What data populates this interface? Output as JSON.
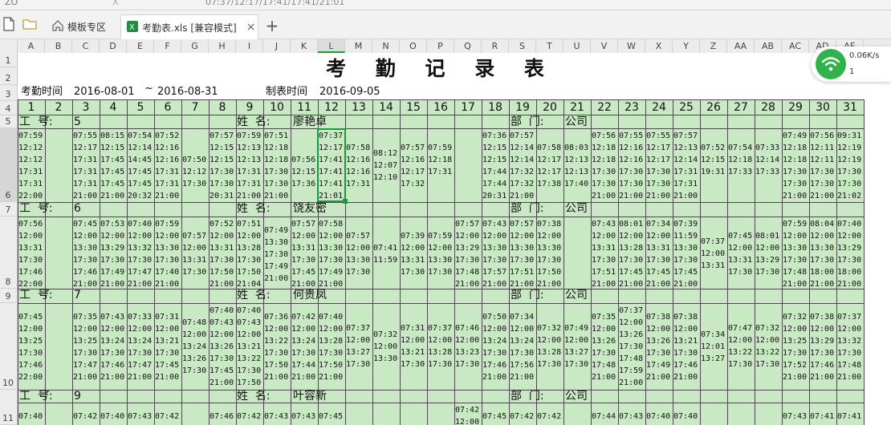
{
  "window": {
    "top_fragment_left": "ZO",
    "top_fragment_middle": "X",
    "top_fragment_right": "07:37/12:17/17:41/17:41/21:01"
  },
  "tabs": [
    {
      "label": "",
      "icon": "new-document-icon"
    },
    {
      "label": "",
      "icon": "folder-icon"
    },
    {
      "label": "模板专区",
      "icon": "home-icon"
    },
    {
      "label": "考勤表.xls  [兼容模式]",
      "icon": "excel-icon",
      "active": true
    }
  ],
  "tab_close": "×",
  "tab_add": "+",
  "columns": [
    "A",
    "B",
    "C",
    "D",
    "E",
    "F",
    "G",
    "H",
    "I",
    "J",
    "K",
    "L",
    "M",
    "N",
    "O",
    "P",
    "Q",
    "R",
    "S",
    "T",
    "U",
    "V",
    "W",
    "X",
    "Y",
    "Z",
    "AA",
    "AB",
    "AC",
    "AD",
    "AE"
  ],
  "selected_column": "L",
  "rows": [
    "1",
    "2",
    "3",
    "4",
    "5",
    "6",
    "7",
    "8",
    "9",
    "10",
    "11"
  ],
  "selected_row": "6",
  "sheet": {
    "title": "考 勤 记 录 表",
    "attendance_label": "考勤时间",
    "attendance_start": "2016-08-01",
    "attendance_sep": "~",
    "attendance_end": "2016-08-31",
    "made_label": "制表时间",
    "made_date": "2016-09-05",
    "days": [
      "1",
      "2",
      "3",
      "4",
      "5",
      "6",
      "7",
      "8",
      "9",
      "10",
      "11",
      "12",
      "13",
      "14",
      "15",
      "16",
      "17",
      "18",
      "19",
      "20",
      "21",
      "22",
      "23",
      "24",
      "25",
      "26",
      "27",
      "28",
      "29",
      "30",
      "31"
    ],
    "id_label": "工  号:",
    "name_label": "姓  名:",
    "dept_label": "部  门:",
    "employees": [
      {
        "id": "5",
        "name": "廖艳卓",
        "dept": "公司",
        "cells": [
          "07:59\n12:12\n12:12\n17:31\n17:31\n22:00",
          "",
          "07:55\n12:17\n17:31\n17:31\n17:31\n21:00",
          "08:15\n12:15\n17:45\n17:45\n17:45\n21:00",
          "07:54\n12:14\n14:45\n17:45\n17:45\n20:32",
          "07:52\n12:16\n12:16\n17:31\n17:31\n21:00",
          "07:50\n12:12\n17:30",
          "07:57\n12:15\n12:15\n17:30\n17:30\n20:31",
          "07:59\n12:13\n12:13\n17:31\n17:31\n21:00",
          "07:51\n12:18\n12:18\n17:30\n17:30\n21:00",
          "07:56\n12:15\n17:36",
          "07:37\n12:17\n17:41\n17:41\n17:41\n21:01",
          "07:58\n12:16\n12:16\n17:31",
          "08:12\n12:07\n12:10",
          "07:57\n12:16\n12:17\n17:32",
          "07:59\n12:18\n17:31",
          "",
          "07:36\n12:15\n12:15\n17:44\n17:44\n20:31",
          "07:57\n12:14\n12:14\n17:32\n17:32\n21:00",
          "07:58\n12:17\n12:17\n17:38",
          "08:03\n12:13\n12:13\n17:40",
          "07:56\n12:18\n12:18\n17:30\n17:30\n21:00",
          "07:55\n12:16\n12:16\n17:30\n17:30\n21:00",
          "07:55\n12:17\n12:17\n17:30\n17:30\n21:00",
          "07:57\n12:13\n12:14\n17:31\n17:31\n21:00",
          "07:52\n12:15\n19:31",
          "07:54\n12:18\n17:33",
          "07:33\n12:14\n17:33",
          "07:49\n12:18\n12:18\n17:30\n17:30\n21:00",
          "07:56\n12:11\n12:11\n17:30\n17:30\n21:00",
          "09:31\n12:19\n12:19\n17:30\n17:30\n21:02"
        ]
      },
      {
        "id": "6",
        "name": "饶友密",
        "dept": "公司",
        "cells": [
          "07:56\n12:00\n13:31\n17:30\n17:46\n22:00",
          "",
          "07:45\n12:00\n13:30\n17:30\n17:46\n21:00",
          "07:53\n12:00\n13:29\n17:30\n17:49\n21:00",
          "07:40\n12:00\n13:32\n17:30\n17:47\n21:00",
          "07:59\n12:00\n13:30\n17:30\n17:40\n21:00",
          "07:57\n12:00\n13:31\n17:30",
          "07:52\n12:00\n13:31\n17:30\n17:50\n21:00",
          "07:51\n12:00\n13:28\n17:30\n17:50\n21:04",
          "07:49\n13:30\n17:30\n17:49\n21:00",
          "07:57\n12:00\n13:31\n17:30\n17:45\n21:00",
          "07:58\n12:00\n13:30\n17:30\n17:49\n21:00",
          "07:57\n12:00\n13:30\n17:30",
          "07:41\n11:59",
          "07:39\n12:00\n13:31\n17:30",
          "07:59\n12:00\n13:30\n17:30",
          "07:57\n12:00\n13:29\n17:30\n17:48\n21:00",
          "07:43\n12:00\n13:30\n17:30\n17:57\n21:00",
          "07:57\n12:00\n13:30\n17:30\n17:51\n21:00",
          "07:38\n12:00\n13:30\n17:30\n17:50\n21:00",
          "",
          "07:43\n12:00\n13:31\n17:30\n17:51\n21:00",
          "08:01\n12:00\n13:28\n17:30\n17:45\n21:00",
          "07:34\n12:00\n13:31\n17:30\n17:45\n21:00",
          "07:39\n11:59\n13:30\n17:30\n17:45\n21:00",
          "07:37\n12:00\n13:31",
          "07:45\n12:00\n13:31\n17:30",
          "08:01\n12:00\n13:29\n17:30",
          "07:59\n12:00\n13:30\n17:30\n17:48\n21:00",
          "08:04\n12:00\n13:30\n17:30\n18:00\n21:00",
          "07:40\n12:00\n13:29\n17:30\n18:00\n21:00"
        ]
      },
      {
        "id": "7",
        "name": "何贵凤",
        "dept": "公司",
        "cells": [
          "07:45\n12:00\n13:25\n17:30\n17:46\n22:00",
          "",
          "07:35\n12:00\n13:25\n17:30\n17:47\n21:00",
          "07:43\n12:00\n13:24\n17:30\n17:46\n21:00",
          "07:33\n12:00\n13:24\n17:30\n17:47\n21:00",
          "07:31\n12:00\n13:21\n17:30\n17:45\n21:00",
          "07:48\n12:00\n13:24\n13:26\n17:30",
          "07:40\n07:43\n12:00\n13:26\n17:30\n17:45\n21:00",
          "07:40\n07:43\n12:00\n13:21\n13:22\n17:30\n17:50\n21:00",
          "07:36\n12:00\n13:22\n17:30\n17:50\n21:00",
          "07:42\n12:00\n13:24\n17:30\n17:44\n21:00",
          "07:40\n12:00\n13:28\n17:30\n17:50\n21:00",
          "07:37\n12:00\n13:27\n17:30",
          "07:32\n12:00\n13:30",
          "07:31\n12:00\n13:21\n17:30",
          "07:37\n12:00\n13:28\n17:30",
          "07:46\n12:00\n13:23\n17:30",
          "07:50\n12:00\n13:24\n17:30\n17:46\n21:00",
          "07:34\n12:00\n13:24\n17:30\n17:56\n21:00",
          "07:32\n12:00\n13:28\n17:30",
          "07:49\n12:00\n13:27\n17:30",
          "07:35\n12:00\n13:26\n17:30\n17:48\n21:00",
          "07:37\n12:00\n13:26\n17:30\n17:48\n17:59\n21:00",
          "07:38\n12:00\n13:26\n17:30\n17:49\n21:00",
          "07:38\n12:00\n13:21\n17:30\n17:46\n21:00",
          "07:34\n12:01\n13:27",
          "07:47\n12:00\n13:22\n17:30",
          "07:32\n12:00\n13:22\n17:30",
          "07:32\n12:00\n13:25\n17:30\n17:52\n21:00",
          "07:38\n12:00\n13:29\n17:30\n17:46\n21:00",
          "07:37\n12:00\n13:32\n17:30\n17:48\n21:00"
        ]
      },
      {
        "id": "9",
        "name": "叶容新",
        "dept": "公司",
        "cells": [
          "07:40",
          "",
          "07:42",
          "07:40",
          "07:43",
          "07:42",
          "",
          "07:46",
          "07:42",
          "07:43",
          "07:43",
          "07:45",
          "",
          "",
          "",
          "",
          "07:42\n12:00",
          "07:45",
          "07:42",
          "07:42",
          "",
          "07:44",
          "07:43",
          "07:40",
          "07:40",
          "",
          "",
          "",
          "07:43",
          "07:41",
          "07:41"
        ]
      }
    ]
  },
  "network_widget": {
    "speed": "0.06K/s",
    "count": "1"
  }
}
